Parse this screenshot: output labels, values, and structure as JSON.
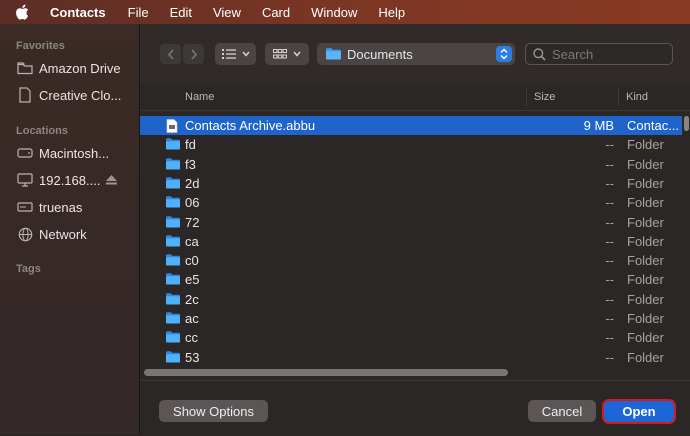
{
  "menubar": {
    "app_name": "Contacts",
    "items": [
      "File",
      "Edit",
      "View",
      "Card",
      "Window",
      "Help"
    ]
  },
  "sidebar": {
    "favorites_label": "Favorites",
    "favorites": [
      {
        "label": "Amazon Drive",
        "icon": "folder-icon"
      },
      {
        "label": "Creative Clo...",
        "icon": "document-icon"
      }
    ],
    "locations_label": "Locations",
    "locations": [
      {
        "label": "Macintosh...",
        "icon": "hard-drive-icon"
      },
      {
        "label": "192.168....",
        "icon": "display-icon",
        "eject": true
      },
      {
        "label": "truenas",
        "icon": "server-icon"
      },
      {
        "label": "Network",
        "icon": "globe-icon"
      }
    ],
    "tags_label": "Tags"
  },
  "toolbar": {
    "location": "Documents",
    "search_placeholder": "Search"
  },
  "columns": {
    "name": "Name",
    "size": "Size",
    "kind": "Kind"
  },
  "files": [
    {
      "name": "Contacts Archive.abbu",
      "size": "9 MB",
      "kind": "Contac...",
      "type": "file",
      "selected": true
    },
    {
      "name": "fd",
      "size": "--",
      "kind": "Folder",
      "type": "folder"
    },
    {
      "name": "f3",
      "size": "--",
      "kind": "Folder",
      "type": "folder"
    },
    {
      "name": "2d",
      "size": "--",
      "kind": "Folder",
      "type": "folder"
    },
    {
      "name": "06",
      "size": "--",
      "kind": "Folder",
      "type": "folder"
    },
    {
      "name": "72",
      "size": "--",
      "kind": "Folder",
      "type": "folder"
    },
    {
      "name": "ca",
      "size": "--",
      "kind": "Folder",
      "type": "folder"
    },
    {
      "name": "c0",
      "size": "--",
      "kind": "Folder",
      "type": "folder"
    },
    {
      "name": "e5",
      "size": "--",
      "kind": "Folder",
      "type": "folder"
    },
    {
      "name": "2c",
      "size": "--",
      "kind": "Folder",
      "type": "folder"
    },
    {
      "name": "ac",
      "size": "--",
      "kind": "Folder",
      "type": "folder"
    },
    {
      "name": "cc",
      "size": "--",
      "kind": "Folder",
      "type": "folder"
    },
    {
      "name": "53",
      "size": "--",
      "kind": "Folder",
      "type": "folder"
    }
  ],
  "footer": {
    "show_options": "Show Options",
    "cancel": "Cancel",
    "open": "Open"
  },
  "colors": {
    "accent": "#1f64c8",
    "open_highlight": "#d41b1b",
    "folder": "#3a9bf0"
  }
}
